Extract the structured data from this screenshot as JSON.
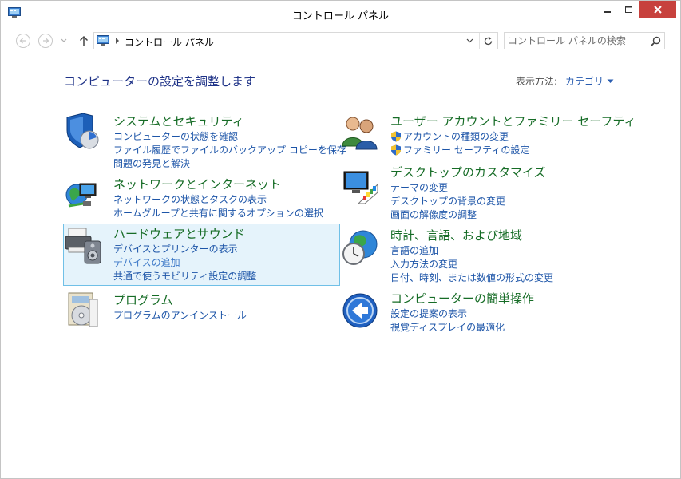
{
  "window": {
    "title": "コントロール パネル"
  },
  "nav": {
    "breadcrumb": "コントロール パネル",
    "search_placeholder": "コントロール パネルの検索"
  },
  "content": {
    "heading": "コンピューターの設定を調整します",
    "view_by_label": "表示方法:",
    "view_by_value": "カテゴリ"
  },
  "categories": [
    {
      "title": "システムとセキュリティ",
      "icon": "shield-icon",
      "links": [
        "コンピューターの状態を確認",
        "ファイル履歴でファイルのバックアップ コピーを保存",
        "問題の発見と解決"
      ]
    },
    {
      "title": "ネットワークとインターネット",
      "icon": "network-globe-icon",
      "links": [
        "ネットワークの状態とタスクの表示",
        "ホームグループと共有に関するオプションの選択"
      ]
    },
    {
      "title": "ハードウェアとサウンド",
      "icon": "printer-speaker-icon",
      "links": [
        "デバイスとプリンターの表示",
        "デバイスの追加",
        "共通で使うモビリティ設定の調整"
      ]
    },
    {
      "title": "プログラム",
      "icon": "programs-icon",
      "links": [
        "プログラムのアンインストール"
      ]
    },
    {
      "title": "ユーザー アカウントとファミリー セーフティ",
      "icon": "users-icon",
      "links": [
        "アカウントの種類の変更",
        "ファミリー セーフティの設定"
      ]
    },
    {
      "title": "デスクトップのカスタマイズ",
      "icon": "monitor-palette-icon",
      "links": [
        "テーマの変更",
        "デスクトップの背景の変更",
        "画面の解像度の調整"
      ]
    },
    {
      "title": "時計、言語、および地域",
      "icon": "clock-globe-icon",
      "links": [
        "言語の追加",
        "入力方法の変更",
        "日付、時刻、または数値の形式の変更"
      ]
    },
    {
      "title": "コンピューターの簡単操作",
      "icon": "ease-of-access-icon",
      "links": [
        "設定の提案の表示",
        "視覚ディスプレイの最適化"
      ]
    }
  ],
  "colors": {
    "category_title": "#166c26",
    "link": "#1d55a8",
    "heading": "#1e3287",
    "highlight_bg": "#e5f3fb",
    "highlight_border": "#70c0e7",
    "close_button": "#c7413d"
  }
}
